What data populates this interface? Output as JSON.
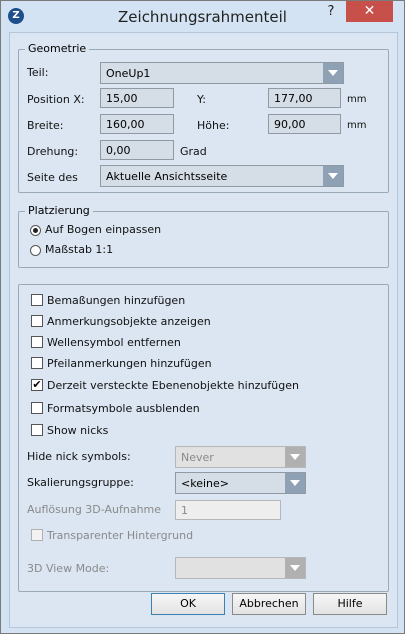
{
  "window": {
    "title": "Zeichnungsrahmenteil",
    "help_label": "?",
    "close_label": "✕",
    "app_icon_letter": "Z"
  },
  "geometrie": {
    "legend": "Geometrie",
    "teil_label": "Teil:",
    "teil_value": "OneUp1",
    "position_x_label": "Position X:",
    "position_x_value": "15,00",
    "y_label": "Y:",
    "y_value": "177,00",
    "y_unit": "mm",
    "breite_label": "Breite:",
    "breite_value": "160,00",
    "hoehe_label": "Höhe:",
    "hoehe_value": "90,00",
    "hoehe_unit": "mm",
    "drehung_label": "Drehung:",
    "drehung_value": "0,00",
    "drehung_unit": "Grad",
    "seite_label": "Seite des",
    "seite_value": "Aktuelle Ansichtsseite"
  },
  "platzierung": {
    "legend": "Platzierung",
    "options": [
      {
        "label": "Auf Bogen einpassen",
        "selected": true
      },
      {
        "label": "Maßstab 1:1",
        "selected": false
      }
    ]
  },
  "options": {
    "checkboxes": [
      {
        "label": "Bemaßungen hinzufügen",
        "checked": false
      },
      {
        "label": "Anmerkungsobjekte anzeigen",
        "checked": false
      },
      {
        "label": "Wellensymbol entfernen",
        "checked": false
      },
      {
        "label": "Pfeilanmerkungen hinzufügen",
        "checked": false
      },
      {
        "label": "Derzeit versteckte Ebenenobjekte hinzufügen",
        "checked": true
      },
      {
        "label": "Formatsymbole ausblenden",
        "checked": false
      },
      {
        "label": "Show nicks",
        "checked": false
      }
    ],
    "hide_nick_label": "Hide nick symbols:",
    "hide_nick_value": "Never",
    "skalierung_label": "Skalierungsgruppe:",
    "skalierung_value": "<keine>",
    "aufloesung_label": "Auflösung 3D-Aufnahme",
    "aufloesung_value": "1",
    "transparent_label": "Transparenter Hintergrund",
    "view_mode_label": "3D View Mode:",
    "view_mode_value": ""
  },
  "buttons": {
    "ok": "OK",
    "cancel": "Abbrechen",
    "help": "Hilfe"
  }
}
